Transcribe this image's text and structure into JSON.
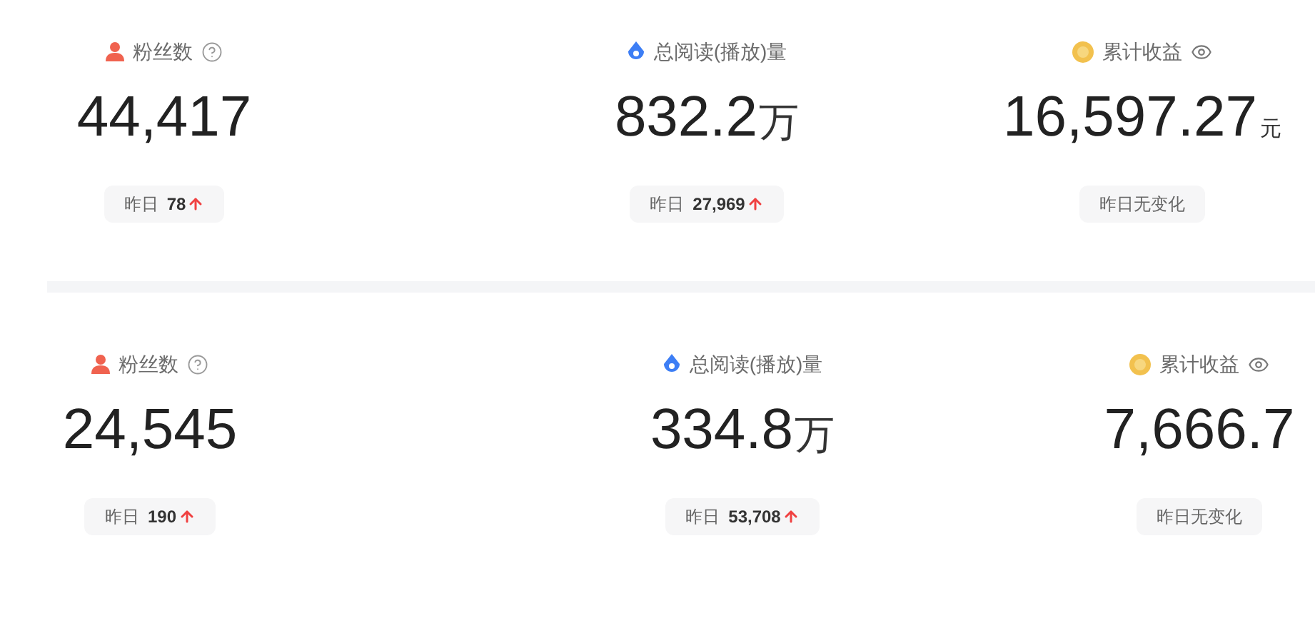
{
  "panels": [
    {
      "stats": [
        {
          "kind": "fans",
          "label": "粉丝数",
          "value": "44,417",
          "change": {
            "kind": "delta",
            "label": "昨日",
            "value": "78",
            "rising": true
          }
        },
        {
          "kind": "reads",
          "label": "总阅读(播放)量",
          "value": "832.2",
          "unit": "万",
          "change": {
            "kind": "delta",
            "label": "昨日",
            "value": "27,969",
            "rising": true
          }
        },
        {
          "kind": "earnings",
          "label": "累计收益",
          "value": "16,597.27",
          "unit": "元",
          "change": {
            "kind": "note",
            "label": "昨日无变化"
          }
        }
      ]
    },
    {
      "stats": [
        {
          "kind": "fans",
          "label": "粉丝数",
          "value": "24,545",
          "change": {
            "kind": "delta",
            "label": "昨日",
            "value": "190",
            "rising": true
          }
        },
        {
          "kind": "reads",
          "label": "总阅读(播放)量",
          "value": "334.8",
          "unit": "万",
          "change": {
            "kind": "delta",
            "label": "昨日",
            "value": "53,708",
            "rising": true
          }
        },
        {
          "kind": "earnings",
          "label": "累计收益",
          "value": "7,666.7",
          "change": {
            "kind": "note",
            "label": "昨日无变化"
          }
        }
      ]
    }
  ]
}
